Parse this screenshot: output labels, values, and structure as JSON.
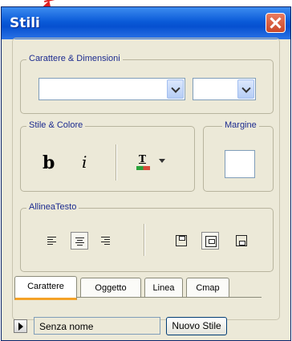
{
  "window": {
    "title": "Stili"
  },
  "annotation": {
    "arrow_color": "#e02020"
  },
  "groups": {
    "font_size": "Carattere & Dimensioni",
    "style_color": "Stile & Colore",
    "margin": "Margine",
    "align_text": "AllineaTesto"
  },
  "font": {
    "family_value": "",
    "size_value": ""
  },
  "style": {
    "bold": "b",
    "italic": "i",
    "color_icon_letter": "T"
  },
  "tabs": [
    "Carattere",
    "Oggetto",
    "Linea",
    "Cmap"
  ],
  "active_tab": "Carattere",
  "footer": {
    "style_name": "Senza nome",
    "new_style_button": "Nuovo Stile"
  },
  "colors": {
    "titlebar": "#0a5ad8",
    "tab_active_underline": "#f4a227",
    "group_legend": "#1c2b8f"
  }
}
